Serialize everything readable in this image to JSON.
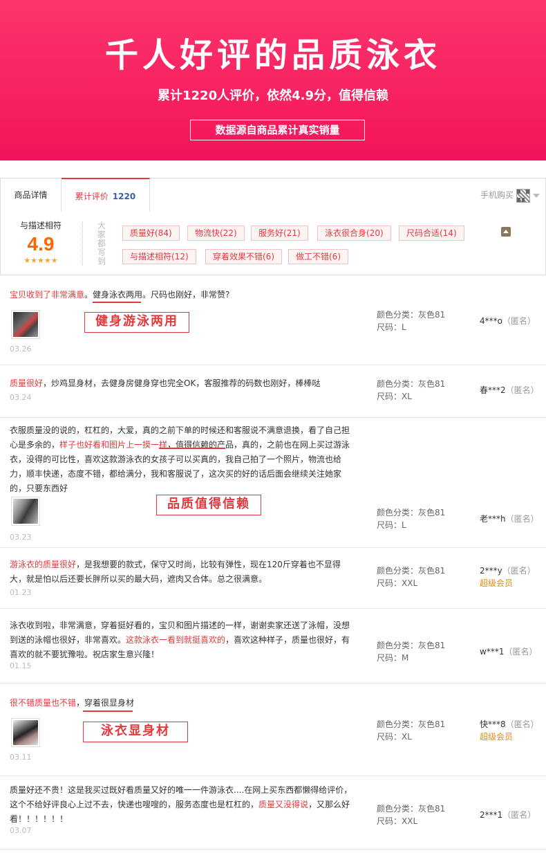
{
  "banner": {
    "title": "千人好评的品质泳衣",
    "subtitle": "累计1220人评价，依然4.9分，值得信赖",
    "box": "数据源自商品累计真实销量"
  },
  "tabs": {
    "details": "商品详情",
    "reviews": "累计评价",
    "reviews_count": "1220",
    "mobile": "手机购买"
  },
  "summary": {
    "label": "与描述相符",
    "score": "4.9",
    "stars": "★★★★★",
    "vertical": "大家都写到",
    "tags": [
      "质量好(84)",
      "物流快(22)",
      "服务好(21)",
      "泳衣很合身(20)",
      "尺码合适(14)",
      "与描述相符(12)",
      "穿着效果不错(6)",
      "做工不错(6)"
    ]
  },
  "reviews": [
    {
      "parts": [
        {
          "t": "宝贝收到了非常满意",
          "r": true
        },
        {
          "t": "。健身泳衣两用。尺码也刚好，非常赞?",
          "r": false
        }
      ],
      "callout": "健身游泳两用",
      "date": "03.26",
      "color": "颜色分类：灰色81",
      "size": "尺码：L",
      "user": "4***o",
      "anon": "（匿名）",
      "vip": ""
    },
    {
      "parts": [
        {
          "t": "质量很好",
          "r": true
        },
        {
          "t": "，炒鸡显身材，去健身房健身穿也完全OK，客服推荐的码数也刚好，棒棒哒",
          "r": false
        }
      ],
      "callout": "",
      "date": "03.24",
      "color": "颜色分类：灰色81",
      "size": "尺码：XL",
      "user": "春***2",
      "anon": "（匿名）",
      "vip": ""
    },
    {
      "parts": [
        {
          "t": "衣服质量没的说的，杠杠的，大爱，真的之前下单的时候还和客服说不满意退换，看了自己担心是多余的，",
          "r": false
        },
        {
          "t": "样子也好看和图片上一摸一样",
          "r": true
        },
        {
          "t": "，值得信赖的产品，真的，之前也在网上买过游泳衣，没得的可比性，喜欢这款游泳衣的女孩子可以买真的，我自己拍了一个照片，物流也给力，顺丰快递，态度不错，都给满分，我和客服说了，这次买的好的话后面会继续关注她家的，只要东西好",
          "r": false
        }
      ],
      "callout": "品质值得信赖",
      "date": "03.23",
      "color": "颜色分类：灰色81",
      "size": "尺码：L",
      "user": "老***h",
      "anon": "（匿名）",
      "vip": ""
    },
    {
      "parts": [
        {
          "t": "游泳衣的质量很好",
          "r": true
        },
        {
          "t": "，是我想要的款式，保守又时尚，比较有弹性，现在120斤穿着也不显得大，就是怕以后还要长胖所以买的最大码，遮肉又合体。总之很满意。",
          "r": false
        }
      ],
      "callout": "",
      "date": "01.23",
      "color": "颜色分类：灰色81",
      "size": "尺码：XXL",
      "user": "2***y",
      "anon": "（匿名）",
      "vip": "超级会员"
    },
    {
      "parts": [
        {
          "t": "泳衣收到啦，非常满意，穿着挺好看的，宝贝和图片描述的一样，谢谢卖家还送了泳帽，没想到送的泳帽也很好，非常喜欢。",
          "r": false
        },
        {
          "t": "这款泳衣一看到就挺喜欢的",
          "r": true
        },
        {
          "t": "，喜欢这种样子，质量也很好，有喜欢的就不要犹豫啦。祝店家生意兴隆！",
          "r": false
        }
      ],
      "callout": "",
      "date": "01.15",
      "color": "颜色分类：灰色81",
      "size": "尺码：M",
      "user": "w***1",
      "anon": "（匿名）",
      "vip": ""
    },
    {
      "parts": [
        {
          "t": "很不错质量也不错",
          "r": true
        },
        {
          "t": "，穿着很显身材",
          "r": false
        }
      ],
      "callout": "泳衣显身材",
      "date": "03.11",
      "color": "颜色分类：灰色81",
      "size": "尺码：XL",
      "user": "快***8",
      "anon": "（匿名）",
      "vip": "超级会员"
    },
    {
      "parts": [
        {
          "t": "质量好还不贵！这是我买过既好看质量又好的唯一一件游泳衣....在网上买东西都懒得给评价，这个不给好评良心上过不去，快递也嗖嗖的，服务态度也是杠杠的，",
          "r": false
        },
        {
          "t": "质量又没得说",
          "r": true
        },
        {
          "t": "，又那么好看！！！！！！",
          "r": false
        }
      ],
      "callout": "",
      "date": "03.07",
      "color": "颜色分类：灰色81",
      "size": "尺码：XXL",
      "user": "2***1",
      "anon": "（匿名）",
      "vip": ""
    }
  ]
}
